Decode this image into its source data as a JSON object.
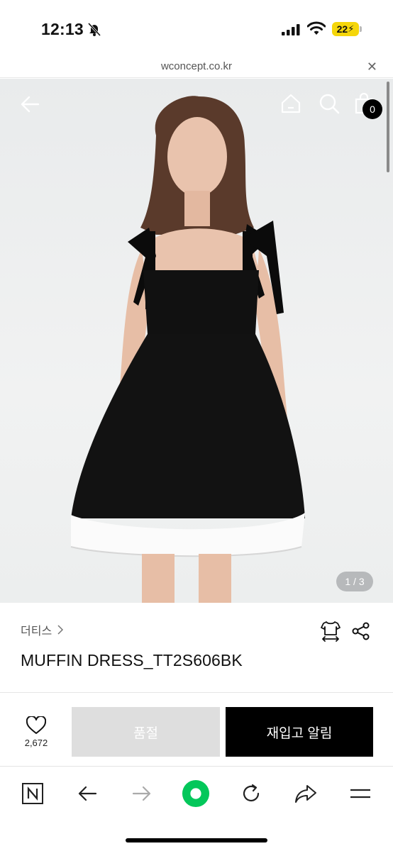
{
  "status_bar": {
    "time": "12:13",
    "battery": "22"
  },
  "browser": {
    "url": "wconcept.co.kr"
  },
  "header": {
    "cart_count": "0"
  },
  "gallery": {
    "pager": "1 / 3"
  },
  "product": {
    "category": "더티스",
    "name": "MUFFIN DRESS_TT2S606BK"
  },
  "actions": {
    "like_count": "2,672",
    "sold_out_label": "품절",
    "restock_label": "재입고 알림"
  },
  "colors": {
    "accent_green": "#03c75a",
    "black": "#000000",
    "soldout_gray": "#dedede",
    "battery_yellow": "#f5d60a"
  },
  "icons": [
    "bell-off-icon",
    "signal-icon",
    "wifi-icon",
    "close-icon",
    "back-arrow-icon",
    "home-icon",
    "search-icon",
    "shopping-bag-icon",
    "size-guide-icon",
    "share-icon",
    "heart-icon",
    "naver-n-icon",
    "browser-back-icon",
    "browser-forward-icon",
    "green-dot-icon",
    "refresh-icon",
    "share-arrow-icon",
    "menu-icon"
  ]
}
